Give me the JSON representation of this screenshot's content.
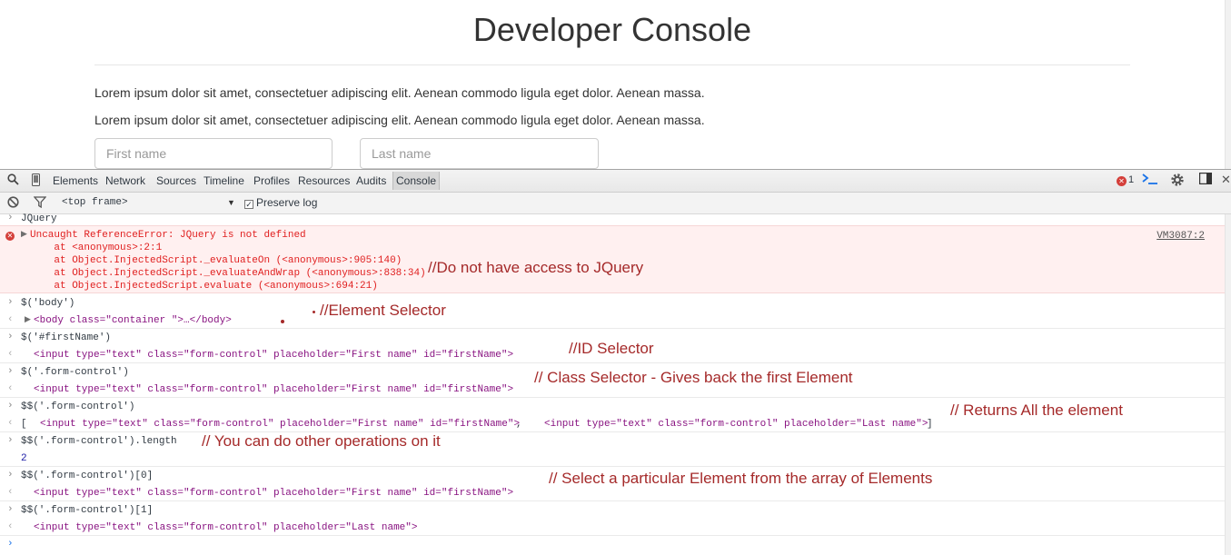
{
  "page": {
    "title": "Developer Console",
    "paragraph1": "Lorem ipsum dolor sit amet, consectetuer adipiscing elit. Aenean commodo ligula eget dolor. Aenean massa.",
    "paragraph2": "Lorem ipsum dolor sit amet, consectetuer adipiscing elit. Aenean commodo ligula eget dolor. Aenean massa.",
    "first_name_placeholder": "First name",
    "last_name_placeholder": "Last name"
  },
  "devtools": {
    "tabs": [
      "Elements",
      "Network",
      "Sources",
      "Timeline",
      "Profiles",
      "Resources",
      "Audits",
      "Console"
    ],
    "active_tab": "Console",
    "error_count": "1",
    "frame": "<top frame>",
    "preserve_log": "Preserve log",
    "icons": [
      "search-icon",
      "device-mode-icon",
      "error-icon",
      "console-drawer-icon",
      "gear-icon",
      "dock-icon",
      "close-icon",
      "clear-icon",
      "filter-icon"
    ]
  },
  "console": {
    "lines": [
      "JQuery",
      "Uncaught ReferenceError: JQuery is not defined",
      "    at <anonymous>:2:1",
      "    at Object.InjectedScript._evaluateOn (<anonymous>:905:140)",
      "    at Object.InjectedScript._evaluateAndWrap (<anonymous>:838:34)",
      "    at Object.InjectedScript.evaluate (<anonymous>:694:21)",
      "$('body')",
      "$('#firstName')",
      "$('.form-control')",
      "$$('.form-control')",
      "$$('.form-control').length",
      "2",
      "$$('.form-control')[0]",
      "$$('.form-control')[1]"
    ],
    "error_link": "VM3087:2",
    "body_output": "<body class=\"container \">…</body>",
    "input_first": "<input type=\"text\" class=\"form-control\" placeholder=\"First name\" id=\"firstName\">",
    "input_last": "<input type=\"text\" class=\"form-control\" placeholder=\"Last name\">",
    "array_output_open": "[",
    "array_output_close": "]"
  },
  "notes": {
    "jquery": "//Do not have access to JQuery",
    "element": "//Element Selector",
    "id": "//ID Selector",
    "class": "// Class Selector - Gives back the first Element",
    "all": "// Returns All the element",
    "ops": "// You can do other operations on it",
    "particular": "// Select a particular Element from the array of Elements"
  },
  "colors": {
    "error_red": "#e02020",
    "note": "#a52a2a",
    "tag": "#881280",
    "attr": "#994500",
    "value": "#1a1aa6"
  }
}
